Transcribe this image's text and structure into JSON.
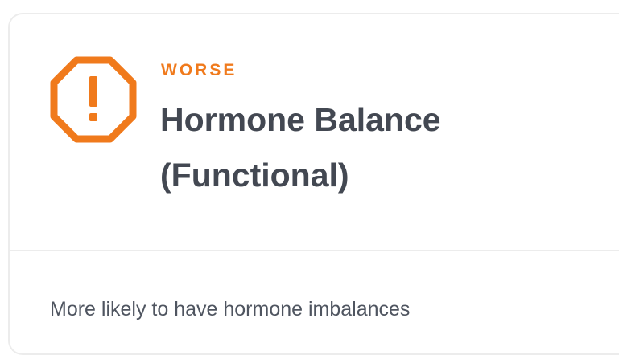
{
  "card": {
    "status_label": "WORSE",
    "title": "Hormone Balance (Functional)",
    "description": "More likely to have hormone imbalances",
    "icon": "warning-octagon-icon"
  },
  "colors": {
    "status_orange": "#f07a1c",
    "title_text": "#434852",
    "body_text": "#4f5560",
    "border": "#ececec"
  }
}
